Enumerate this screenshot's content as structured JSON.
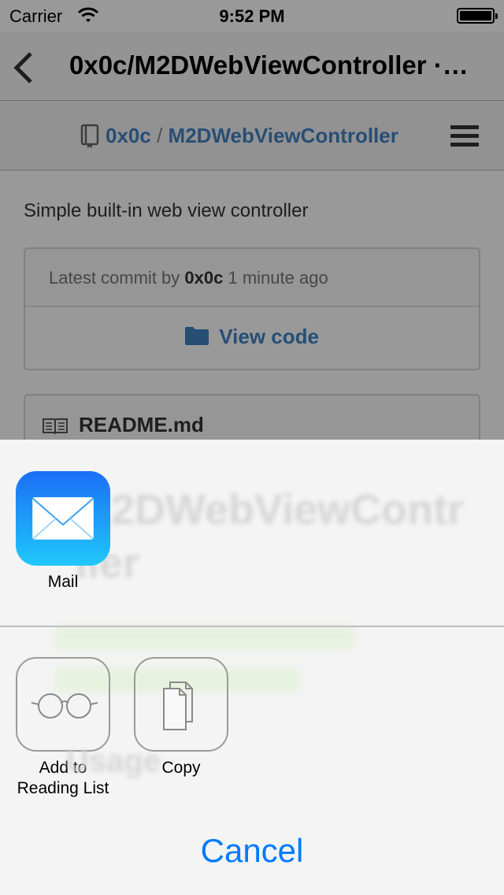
{
  "status_bar": {
    "carrier": "Carrier",
    "time": "9:52 PM"
  },
  "nav": {
    "title": "0x0c/M2DWebViewController ·…"
  },
  "repo": {
    "owner": "0x0c",
    "separator": "/",
    "name": "M2DWebViewController"
  },
  "description": "Simple built-in web view controller",
  "commit": {
    "prefix": "Latest commit by",
    "author": "0x0c",
    "time": "1 minute ago"
  },
  "view_code_label": "View code",
  "readme": {
    "title": "README.md"
  },
  "share_sheet": {
    "share_items": [
      {
        "label": "Mail",
        "icon": "mail-icon"
      }
    ],
    "action_items": [
      {
        "label_line1": "Add to",
        "label_line2": "Reading List",
        "icon": "glasses-icon"
      },
      {
        "label": "Copy",
        "icon": "copy-documents-icon"
      }
    ],
    "cancel_label": "Cancel"
  },
  "colors": {
    "link": "#4183c4",
    "ios_tint": "#007aff",
    "mail_gradient_top": "#1b6ff5",
    "mail_gradient_bottom": "#20c8fb"
  }
}
